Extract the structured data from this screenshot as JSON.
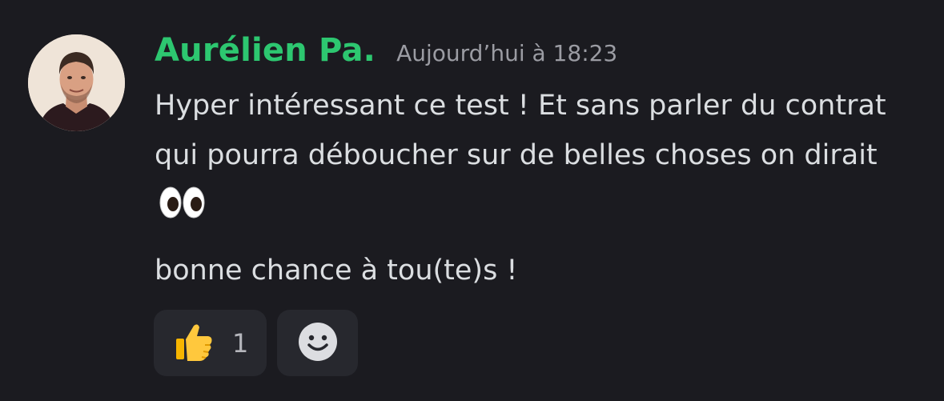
{
  "message": {
    "author": "Aurélien Pa.",
    "timestamp": "Aujourd’hui à 18:23",
    "paragraph1": "Hyper intéressant ce test ! Et sans parler du contrat qui pourra déboucher sur de belles choses on dirait",
    "paragraph1_emoji": "eyes-emoji",
    "paragraph2": "bonne chance à tou(te)s !"
  },
  "reactions": [
    {
      "emoji": "thumbs-up-emoji",
      "count": "1"
    },
    {
      "emoji": "add-reaction-smiley-icon"
    }
  ],
  "colors": {
    "background": "#1b1b20",
    "author": "#2dc770",
    "timestamp": "#9b9ca3",
    "text": "#dbdee1",
    "reaction_bg": "#27282e"
  }
}
